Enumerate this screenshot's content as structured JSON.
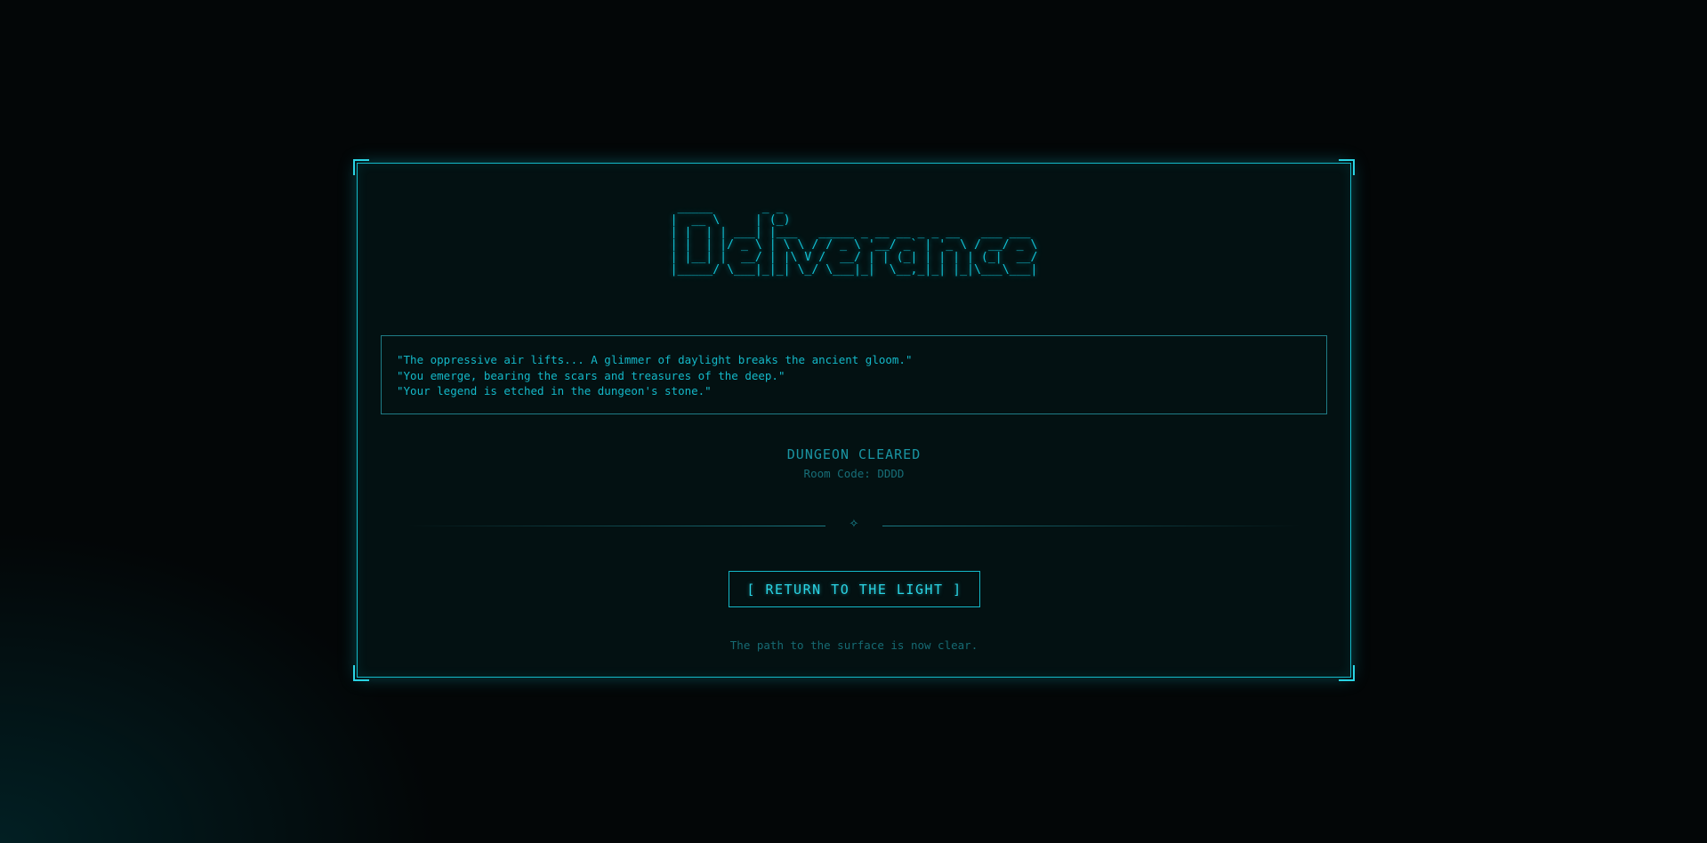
{
  "logo": {
    "ascii": " _____       _ _                                    \n|  __ \\     | (_)                                   \n| |  | | ___| |___   _____ _ __ __ _ _ __   ___ ___ \n| |  | |/ _ \\ | \\ \\ / / _ \\ '__/ _` | '_ \\ / __/ _ \\\n| |__| |  __/ | |\\ V /  __/ | | (_| | | | | (_|  __/\n|_____/ \\___|_|_| \\_/ \\___|_|  \\__,_|_| |_|\\___\\___|",
    "text": "Deliverance"
  },
  "narrative": {
    "lines": [
      "\"The oppressive air lifts... A glimmer of daylight breaks the ancient gloom.\"",
      "\"You emerge, bearing the scars and treasures of the deep.\"",
      "\"Your legend is etched in the dungeon's stone.\""
    ]
  },
  "status": {
    "title": "DUNGEON CLEARED",
    "room_code": "Room Code: DDDD"
  },
  "divider": {
    "symbol": "✧"
  },
  "actions": {
    "return_label": "[ RETURN TO THE LIGHT ]"
  },
  "footer": {
    "note": "The path to the surface is now clear."
  },
  "theme": {
    "accent": "#14b8c8",
    "background": "#030607",
    "panel": "#031112"
  }
}
